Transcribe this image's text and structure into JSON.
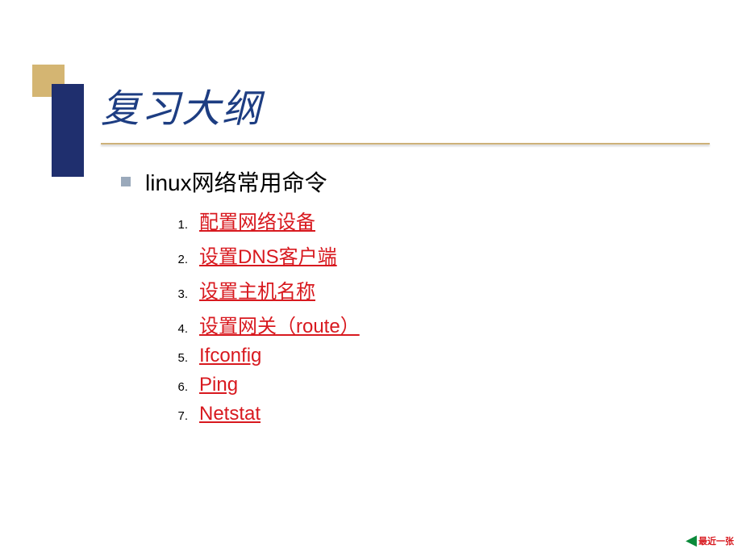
{
  "title": "复习大纲",
  "section": {
    "heading": "linux网络常用命令",
    "items": [
      {
        "num": "1.",
        "label": "配置网络设备"
      },
      {
        "num": "2.",
        "label": "设置DNS客户端"
      },
      {
        "num": "3.",
        "label": "设置主机名称"
      },
      {
        "num": "4.",
        "label": "设置网关（route）"
      },
      {
        "num": "5.",
        "label": "Ifconfig"
      },
      {
        "num": "6.",
        "label": "Ping"
      },
      {
        "num": "7.",
        "label": "Netstat"
      }
    ]
  },
  "nav": {
    "label": "最近一张"
  }
}
